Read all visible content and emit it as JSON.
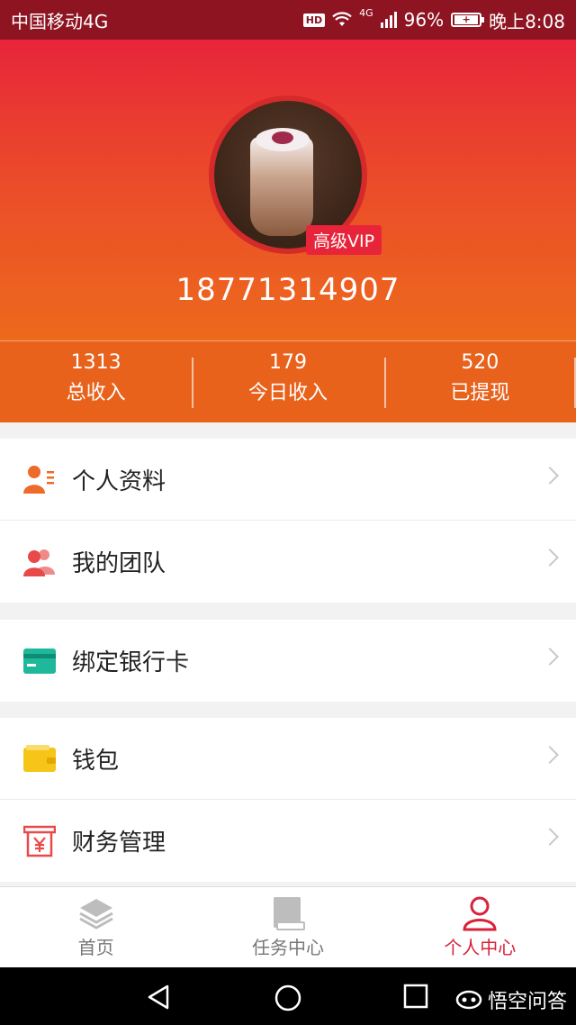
{
  "status_bar": {
    "carrier": "中国移动4G",
    "hd": "HD",
    "network": "4G",
    "battery": "96%",
    "time": "晚上8:08"
  },
  "profile": {
    "vip_label": "高级VIP",
    "phone": "18771314907"
  },
  "stats": [
    {
      "value": "1313",
      "label": "总收入"
    },
    {
      "value": "179",
      "label": "今日收入"
    },
    {
      "value": "520",
      "label": "已提现"
    }
  ],
  "menu": {
    "personal_info": "个人资料",
    "my_team": "我的团队",
    "bind_card": "绑定银行卡",
    "wallet": "钱包",
    "finance": "财务管理"
  },
  "tabs": [
    {
      "label": "首页",
      "icon": "layers-icon"
    },
    {
      "label": "任务中心",
      "icon": "book-icon"
    },
    {
      "label": "个人中心",
      "icon": "person-icon"
    }
  ],
  "watermark": "悟空问答",
  "colors": {
    "header_top": "#e8253a",
    "header_bottom": "#ec6a1c",
    "accent": "#d8223a",
    "stats_bg": "#e8621c"
  }
}
